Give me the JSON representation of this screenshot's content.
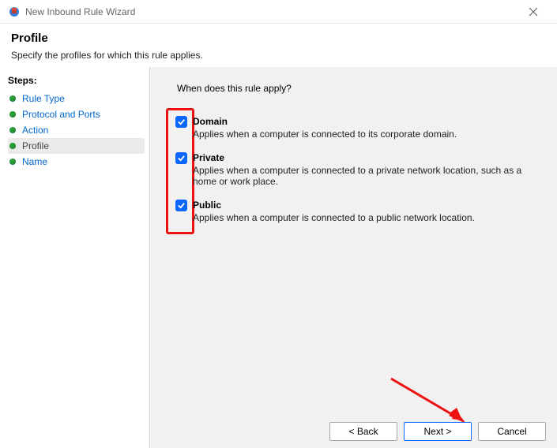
{
  "window": {
    "title": "New Inbound Rule Wizard"
  },
  "header": {
    "title": "Profile",
    "subtitle": "Specify the profiles for which this rule applies."
  },
  "sidebar": {
    "heading": "Steps:",
    "items": [
      {
        "label": "Rule Type"
      },
      {
        "label": "Protocol and Ports"
      },
      {
        "label": "Action"
      },
      {
        "label": "Profile"
      },
      {
        "label": "Name"
      }
    ]
  },
  "content": {
    "question": "When does this rule apply?",
    "options": [
      {
        "label": "Domain",
        "desc": "Applies when a computer is connected to its corporate domain.",
        "checked": true
      },
      {
        "label": "Private",
        "desc": "Applies when a computer is connected to a private network location, such as a home or work place.",
        "checked": true
      },
      {
        "label": "Public",
        "desc": "Applies when a computer is connected to a public network location.",
        "checked": true
      }
    ]
  },
  "buttons": {
    "back": "< Back",
    "next": "Next >",
    "cancel": "Cancel"
  }
}
